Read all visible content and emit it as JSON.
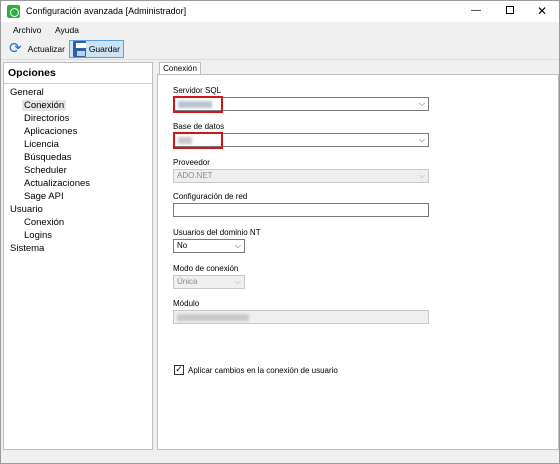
{
  "window": {
    "title": "Configuración avanzada [Administrador]",
    "minimize_glyph": "—",
    "close_glyph": "✕"
  },
  "menu": [
    "Archivo",
    "Ayuda"
  ],
  "toolbar": {
    "refresh_label": "Actualizar",
    "save_label": "Guardar"
  },
  "left": {
    "title": "Opciones",
    "tree": [
      {
        "label": "General",
        "level": 0
      },
      {
        "label": "Conexión",
        "level": 1,
        "selected": true
      },
      {
        "label": "Directorios",
        "level": 1
      },
      {
        "label": "Aplicaciones",
        "level": 1
      },
      {
        "label": "Licencia",
        "level": 1
      },
      {
        "label": "Búsquedas",
        "level": 1
      },
      {
        "label": "Scheduler",
        "level": 1
      },
      {
        "label": "Actualizaciones",
        "level": 1
      },
      {
        "label": "Sage API",
        "level": 1
      },
      {
        "label": "Usuario",
        "level": 0
      },
      {
        "label": "Conexión",
        "level": 1
      },
      {
        "label": "Logins",
        "level": 1
      },
      {
        "label": "Sistema",
        "level": 0
      }
    ]
  },
  "tabs": [
    "Conexión"
  ],
  "form": {
    "servidor_label": "Servidor SQL",
    "base_label": "Base de datos",
    "proveedor_label": "Proveedor",
    "proveedor_value": "ADO.NET",
    "red_label": "Configuración de red",
    "usuarios_nt_label": "Usuarios del dominio NT",
    "usuarios_nt_value": "No",
    "modo_label": "Modo de conexión",
    "modo_value": "Única",
    "modulo_label": "Módulo",
    "checkbox_label": "Aplicar cambios en la conexión de usuario",
    "checkbox_checked": true,
    "chevron_glyph": "⌵",
    "check_glyph": "✓"
  },
  "colors": {
    "highlight": "#d51515",
    "toolbar_active": "#cce4f7",
    "app_icon": "#2fae3f"
  }
}
